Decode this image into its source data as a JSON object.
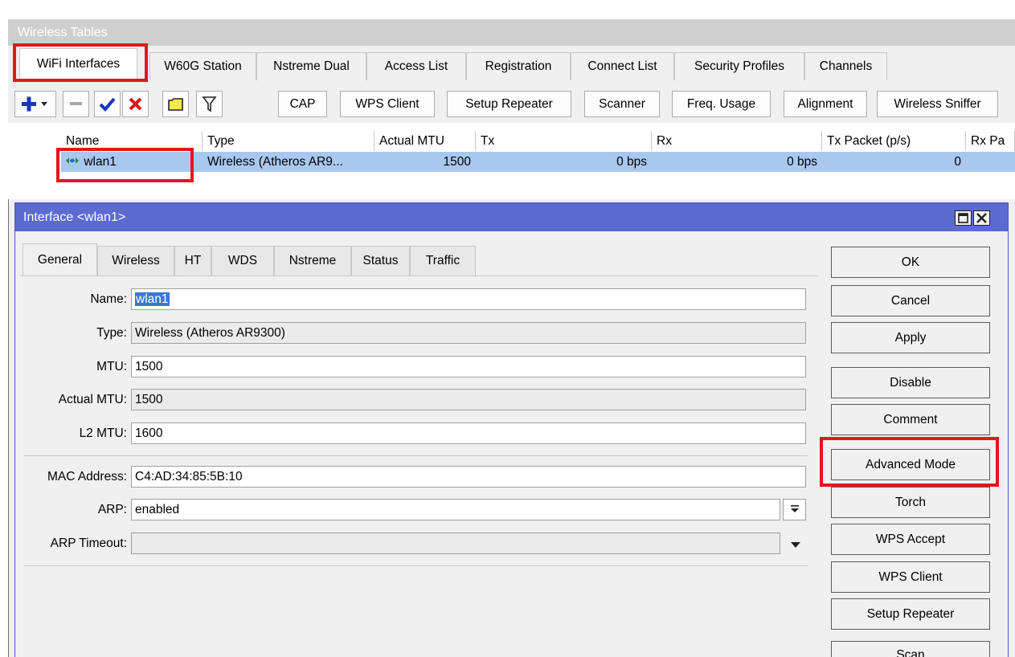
{
  "outer_window": {
    "title": "Wireless Tables",
    "tabs": [
      {
        "label": "WiFi Interfaces",
        "active": true
      },
      {
        "label": "W60G Station"
      },
      {
        "label": "Nstreme Dual"
      },
      {
        "label": "Access List"
      },
      {
        "label": "Registration"
      },
      {
        "label": "Connect List"
      },
      {
        "label": "Security Profiles"
      },
      {
        "label": "Channels"
      }
    ],
    "toolbar": {
      "icons": [
        "add-dropdown-icon",
        "remove-icon",
        "enable-check-icon",
        "disable-x-icon",
        "comment-icon",
        "filter-icon"
      ],
      "buttons": [
        "CAP",
        "WPS Client",
        "Setup Repeater",
        "Scanner",
        "Freq. Usage",
        "Alignment",
        "Wireless Sniffer"
      ]
    },
    "table": {
      "columns": [
        "Name",
        "Type",
        "Actual MTU",
        "Tx",
        "Rx",
        "Tx Packet (p/s)",
        "Rx Pa"
      ],
      "rows": [
        {
          "name": "wlan1",
          "type": "Wireless (Atheros AR9...",
          "actual_mtu": "1500",
          "tx": "0 bps",
          "rx": "0 bps",
          "tx_packet": "0",
          "rx_packet": ""
        }
      ]
    }
  },
  "dialog": {
    "title": "Interface <wlan1>",
    "tabs": [
      "General",
      "Wireless",
      "HT",
      "WDS",
      "Nstreme",
      "Status",
      "Traffic"
    ],
    "active_tab": "General",
    "fields": {
      "name": {
        "label": "Name:",
        "value": "wlan1"
      },
      "type": {
        "label": "Type:",
        "value": "Wireless (Atheros AR9300)"
      },
      "mtu": {
        "label": "MTU:",
        "value": "1500"
      },
      "actual_mtu": {
        "label": "Actual MTU:",
        "value": "1500"
      },
      "l2_mtu": {
        "label": "L2 MTU:",
        "value": "1600"
      },
      "mac_address": {
        "label": "MAC Address:",
        "value": "C4:AD:34:85:5B:10"
      },
      "arp": {
        "label": "ARP:",
        "value": "enabled"
      },
      "arp_timeout": {
        "label": "ARP Timeout:",
        "value": ""
      }
    },
    "buttons": {
      "ok": "OK",
      "cancel": "Cancel",
      "apply": "Apply",
      "disable": "Disable",
      "comment": "Comment",
      "advanced_mode": "Advanced Mode",
      "torch": "Torch",
      "wps_accept": "WPS Accept",
      "wps_client": "WPS Client",
      "setup_repeater": "Setup Repeater",
      "scan": "Scan"
    }
  },
  "colors": {
    "highlight_box": "#e8141c",
    "dialog_title_bar": "#5b6bd0",
    "selected_row": "#a9c8f0"
  }
}
